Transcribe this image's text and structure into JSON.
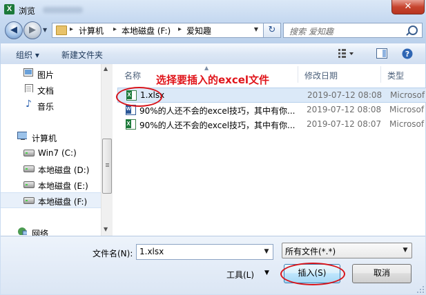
{
  "window": {
    "title": "浏览",
    "close_glyph": "✕",
    "app_icon": "X"
  },
  "address": {
    "path": [
      "计算机",
      "本地磁盘 (F:)",
      "爱知趣"
    ],
    "search_placeholder": "搜索 爱知趣"
  },
  "toolbar": {
    "organize": "组织 ▾",
    "new_folder": "新建文件夹"
  },
  "nav": {
    "items": [
      {
        "label": "图片",
        "icon": "pictures-icon"
      },
      {
        "label": "文档",
        "icon": "documents-icon"
      },
      {
        "label": "音乐",
        "icon": "music-icon"
      },
      {
        "label": "计算机",
        "icon": "computer-icon"
      },
      {
        "label": "Win7 (C:)",
        "icon": "drive-icon"
      },
      {
        "label": "本地磁盘 (D:)",
        "icon": "drive-icon"
      },
      {
        "label": "本地磁盘 (E:)",
        "icon": "drive-icon"
      },
      {
        "label": "本地磁盘 (F:)",
        "icon": "drive-icon",
        "selected": true
      },
      {
        "label": "网络",
        "icon": "network-icon"
      }
    ]
  },
  "columns": {
    "name": "名称",
    "date": "修改日期",
    "type": "类型"
  },
  "files": [
    {
      "name": "1.xlsx",
      "date": "2019-07-12 08:08",
      "type": "Microsof",
      "icon": "excel-icon",
      "selected": true
    },
    {
      "name": "90%的人还不会的excel技巧，其中有你...",
      "date": "2019-07-12 08:08",
      "type": "Microsof",
      "icon": "word-icon"
    },
    {
      "name": "90%的人还不会的excel技巧，其中有你...",
      "date": "2019-07-12 08:07",
      "type": "Microsof",
      "icon": "excel-icon"
    }
  ],
  "annotation": "选择要插入的excel文件",
  "bottom": {
    "filename_label": "文件名(N):",
    "filename_value": "1.xlsx",
    "filetype_value": "所有文件(*.*)",
    "tools_label": "工具(L)",
    "insert_button": "插入(S)",
    "cancel_button": "取消"
  },
  "colors": {
    "annotation": "#e0141a",
    "selection": "#dbe9f8"
  }
}
